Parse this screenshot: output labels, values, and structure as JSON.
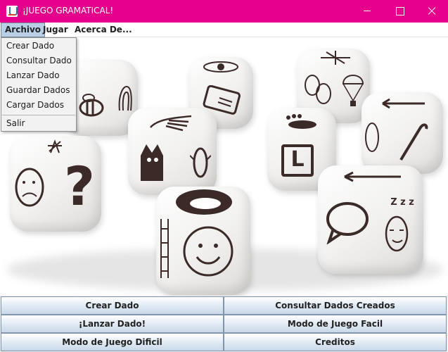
{
  "window": {
    "title": "¡JUEGO GRAMATICAL!"
  },
  "menubar": {
    "items": [
      "Archivo",
      "Jugar",
      "Acerca De..."
    ]
  },
  "archivo_menu": {
    "items": [
      "Crear Dado",
      "Consultar Dado",
      "Lanzar Dado",
      "Guardar Dados",
      "Cargar Dados"
    ],
    "exit": "Salir"
  },
  "buttons": {
    "crear_dado": "Crear Dado",
    "consultar_dados": "Consultar Dados Creados",
    "lanzar_dado": "¡Lanzar Dado!",
    "modo_facil": "Modo de Juego Facil",
    "modo_dificil": "Modo de Juego Dificil",
    "creditos": "Creditos"
  },
  "image": {
    "glyphs": {
      "question": "?",
      "letter_l": "L",
      "zzz": "Z z z"
    }
  },
  "colors": {
    "titlebar": "#e4008b",
    "menu_highlight": "#b8cfe5",
    "button_face": "#dfe8f1"
  }
}
